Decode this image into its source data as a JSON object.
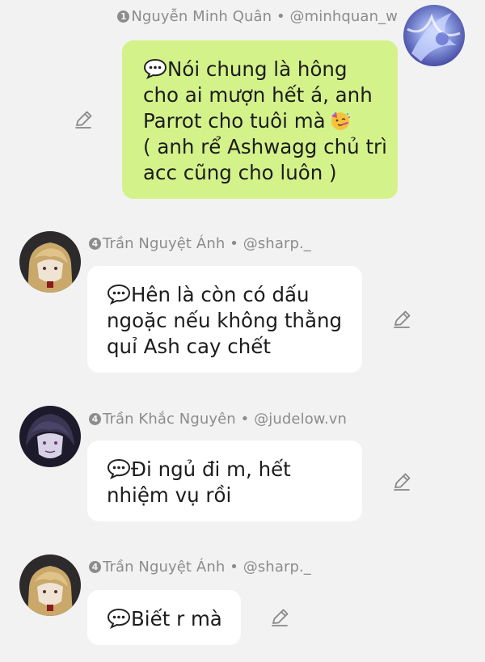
{
  "messages": [
    {
      "sender": {
        "badge": "1",
        "name": "Nguyễn Minh Quân",
        "separator": "•",
        "handle": "@minhquan_w"
      },
      "lines": [
        "Nói chung là hông",
        "cho ai mượn hết á, anh",
        "Parrot cho tuôi mà",
        "( anh rể Ashwagg chủ trì",
        "acc cũng cho luôn )"
      ],
      "emoji": [
        "speech-balloon",
        "partying-face"
      ],
      "colors": {
        "bubble": "#d4f28a"
      }
    },
    {
      "sender": {
        "badge": "4",
        "name": "Trần Nguyệt Ánh",
        "separator": "•",
        "handle": "@sharp._"
      },
      "lines": [
        "Hên là còn có dấu",
        "ngoặc nếu không thằng",
        "quỉ Ash cay chết"
      ],
      "emoji": [
        "speech-balloon"
      ],
      "colors": {
        "bubble": "#ffffff"
      }
    },
    {
      "sender": {
        "badge": "4",
        "name": "Trần Khắc Nguyên",
        "separator": "•",
        "handle": "@judelow.vn"
      },
      "lines": [
        "Đi ngủ đi m, hết",
        "nhiệm vụ rồi"
      ],
      "emoji": [
        "speech-balloon"
      ],
      "colors": {
        "bubble": "#ffffff"
      }
    },
    {
      "sender": {
        "badge": "4",
        "name": "Trần Nguyệt Ánh",
        "separator": "•",
        "handle": "@sharp._"
      },
      "lines": [
        "Biết r mà"
      ],
      "emoji": [
        "speech-balloon"
      ],
      "colors": {
        "bubble": "#ffffff"
      }
    }
  ],
  "icons": {
    "edit": "pencil-icon",
    "emoji_speech": "speech-balloon-emoji",
    "emoji_party": "partying-face-emoji"
  },
  "colors": {
    "background": "#f2f2f2",
    "meta_text": "#8c8c8c",
    "icon_gray": "#888888"
  }
}
